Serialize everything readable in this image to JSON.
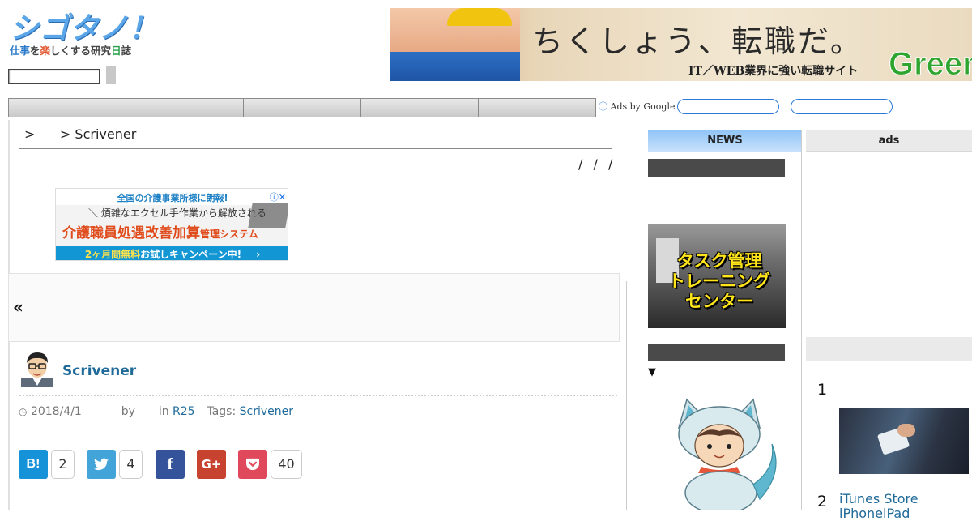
{
  "site": {
    "logo_title": "シゴタノ！",
    "logo_sub_parts": [
      "仕事",
      "を",
      "楽",
      "しくする研究",
      "日",
      "誌"
    ],
    "search_placeholder": ""
  },
  "top_banner": {
    "headline": "ちくしょう、転職だ。",
    "subline": "IT／WEB業界に強い転職サイト",
    "brand": "Green"
  },
  "nav": {
    "items": [
      "",
      "",
      "",
      "",
      ""
    ]
  },
  "ads_bar": {
    "info_icon": "ⓘ",
    "label": "Ads by Google"
  },
  "breadcrumb": {
    "text": ">      > Scrivener"
  },
  "share_slashes": "/ / /",
  "ad": {
    "top_line": "全国の介護事業所様に朗報!",
    "close_icon": "ⓘ✕",
    "line1": "＼ 煩雑なエクセル手作業から解放される",
    "line2_main": "介護職員処遇改善加算",
    "line2_small": "管理システム",
    "bottom_highlight": "2ヶ月間無料",
    "bottom_rest": "お試しキャンペーン中!",
    "bottom_arrow": "›"
  },
  "prev_post": {
    "arrow": "«"
  },
  "post": {
    "title": "Scrivener",
    "date_icon": "clock-icon",
    "date": "2018/4/1",
    "by": "by",
    "in": "in",
    "category": "R25",
    "tags_label": "Tags:",
    "tag": "Scrivener"
  },
  "share": {
    "hatena": {
      "label": "B!",
      "count": "2"
    },
    "twitter": {
      "label": "🐦",
      "count": "4"
    },
    "facebook": {
      "label": "f"
    },
    "gplus": {
      "label": "G+"
    },
    "pocket": {
      "label": "❤",
      "count": "40"
    }
  },
  "sidebar": {
    "news_title": "NEWS",
    "task_banner": [
      "タスク管理",
      "トレーニング",
      "センター"
    ],
    "triangle": "▼"
  },
  "sidebar2": {
    "ads_title": "ads",
    "ranking": [
      {
        "num": "1",
        "title": ""
      },
      {
        "num": "2",
        "title": "iTunes Store iPhoneiPad"
      }
    ]
  }
}
